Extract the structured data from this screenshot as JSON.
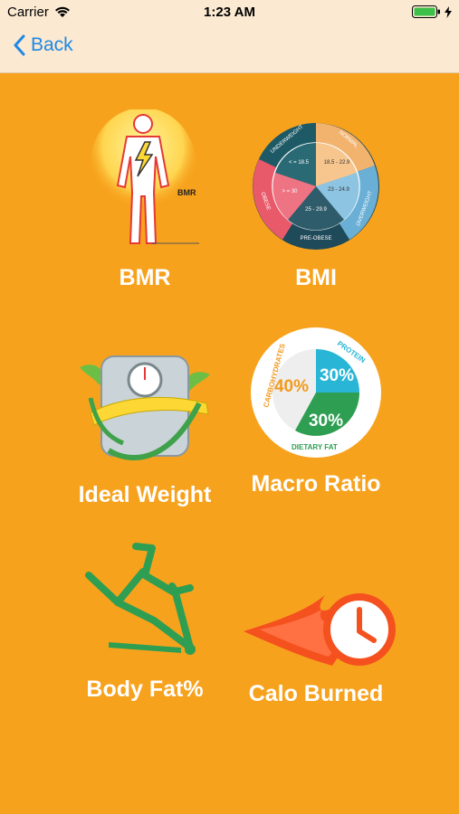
{
  "status": {
    "carrier": "Carrier",
    "time": "1:23 AM"
  },
  "nav": {
    "back_label": "Back"
  },
  "tiles": [
    {
      "label": "BMR"
    },
    {
      "label": "BMI"
    },
    {
      "label": "Ideal Weight"
    },
    {
      "label": "Macro Ratio"
    },
    {
      "label": "Body Fat%"
    },
    {
      "label": "Calo Burned"
    }
  ],
  "bmr_icon": {
    "text": "BMR"
  },
  "bmi_icon": {
    "segments": [
      "UNDERWEIGHT",
      "NORMAL",
      "OVERWEIGHT",
      "PRE-OBESE",
      "OBESE"
    ],
    "values": [
      "< = 18.5",
      "18.5 - 22.9",
      "23 - 24.9",
      "25 - 29.9",
      "> = 30"
    ]
  },
  "macro_icon": {
    "carbs_label": "CARBOHYDRATES",
    "carbs_pct": "40%",
    "protein_label": "PROTEIN",
    "protein_pct": "30%",
    "fat_label": "DIETARY FAT",
    "fat_pct": "30%"
  },
  "colors": {
    "background": "#F7A21D",
    "header": "#FBE9D2",
    "accent": "#1E88E5"
  }
}
